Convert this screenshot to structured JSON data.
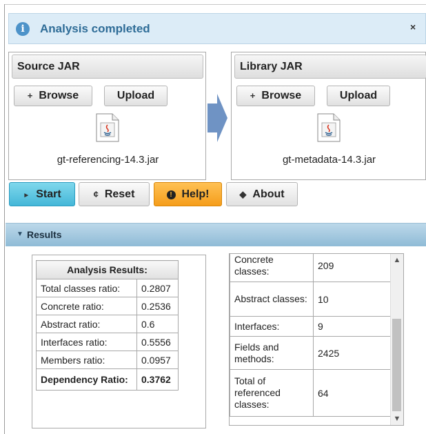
{
  "notification": {
    "message": "Analysis completed",
    "close": "×",
    "icon": "info-icon"
  },
  "source": {
    "title": "Source JAR",
    "browse": "Browse",
    "upload": "Upload",
    "file": "gt-referencing-14.3.jar"
  },
  "library": {
    "title": "Library JAR",
    "browse": "Browse",
    "upload": "Upload",
    "file": "gt-metadata-14.3.jar"
  },
  "actions": {
    "start": "Start",
    "reset": "Reset",
    "help": "Help!",
    "about": "About"
  },
  "results": {
    "section": "Results",
    "table_title": "Analysis Results:",
    "rows": [
      {
        "name": "Total classes ratio:",
        "value": "0.2807"
      },
      {
        "name": "Concrete ratio:",
        "value": "0.2536"
      },
      {
        "name": "Abstract ratio:",
        "value": "0.6"
      },
      {
        "name": "Interfaces ratio:",
        "value": "0.5556"
      },
      {
        "name": "Members ratio:",
        "value": "0.0957"
      },
      {
        "name": "Dependency Ratio:",
        "value": "0.3762"
      }
    ],
    "stats": [
      {
        "name": "Concrete classes:",
        "value": "209"
      },
      {
        "name": "Abstract classes:",
        "value": "10"
      },
      {
        "name": "Interfaces:",
        "value": "9"
      },
      {
        "name": "Fields and methods:",
        "value": "2425"
      },
      {
        "name": "Total of referenced classes:",
        "value": "64"
      }
    ]
  },
  "colors": {
    "accent": "#44b7d8",
    "help": "#f59d1b",
    "notice_bg": "#dcecf7",
    "results_bar": "#8fbbd6"
  }
}
